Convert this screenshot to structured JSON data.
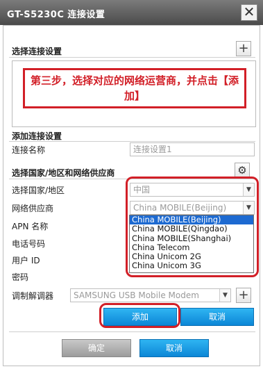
{
  "window": {
    "title": "GT-S5230C 连接设置",
    "close": "✕"
  },
  "section1": {
    "title": "选择连接设置",
    "add_icon": "+"
  },
  "callout": {
    "text": "第三步，选择对应的网络运营商，并点击【添加】"
  },
  "section2": {
    "title": "添加连接设置",
    "name_label": "连接名称",
    "name_value": "连接设置1"
  },
  "section3": {
    "title": "选择国家/地区和网络供应商",
    "country_label": "选择国家/地区",
    "country_value": "中国",
    "provider_label": "网络供应商",
    "provider_value": "China MOBILE(Beijing)",
    "apn_label": "APN 名称",
    "phone_label": "电话号码",
    "userid_label": "用户 ID",
    "password_label": "密码",
    "modem_label": "调制解调器",
    "modem_value": "SAMSUNG USB Mobile Modem",
    "provider_options": [
      "China MOBILE(Beijing)",
      "China MOBILE(Qingdao)",
      "China MOBILE(Shanghai)",
      "China Telecom",
      "China Unicom 2G",
      "China Unicom 3G"
    ],
    "selected_index": 0
  },
  "buttons": {
    "add": "添加",
    "cancel_small": "取消",
    "ok": "确定",
    "cancel": "取消"
  },
  "colors": {
    "accent_blue": "#1a9be3",
    "highlight_red": "#d21f27",
    "selection": "#1d6ad1"
  }
}
